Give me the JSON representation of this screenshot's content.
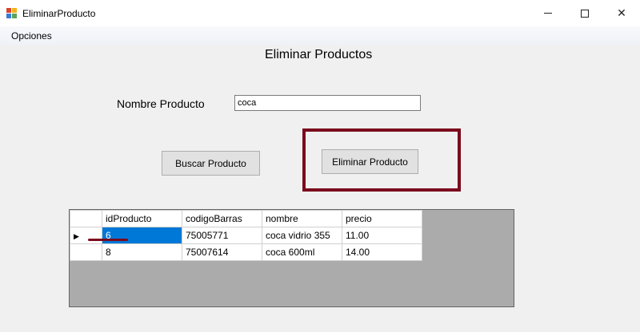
{
  "window": {
    "title": "EliminarProducto",
    "controls": {
      "minimize": "",
      "maximize": "",
      "close": "✕"
    }
  },
  "menu": {
    "items": [
      {
        "label": "Opciones"
      }
    ]
  },
  "form": {
    "title": "Eliminar Productos",
    "name_label": "Nombre Producto",
    "name_value": "coca",
    "search_button": "Buscar Producto",
    "delete_button": "Eliminar Producto"
  },
  "grid": {
    "columns": [
      "idProducto",
      "codigoBarras",
      "nombre",
      "precio"
    ],
    "rows": [
      {
        "indicator": "▶",
        "idProducto": "6",
        "codigoBarras": "75005771",
        "nombre": "coca vidrio 355",
        "precio": "11.00",
        "selected": true
      },
      {
        "indicator": "",
        "idProducto": "8",
        "codigoBarras": "75007614",
        "nombre": "coca 600ml",
        "precio": "14.00",
        "selected": false
      }
    ]
  },
  "colors": {
    "highlight": "#7a0a1c",
    "selection": "#0078d7"
  },
  "icons": {
    "app": "app-form-icon",
    "row_indicator": "triangle-right-icon"
  }
}
